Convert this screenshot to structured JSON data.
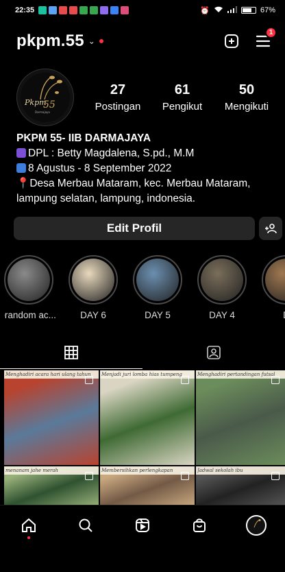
{
  "status_bar": {
    "time": "22:35",
    "battery": "67%",
    "notification_colors": [
      "#19c3a0",
      "#5ba4f5",
      "#e84b4b",
      "#e84b4b",
      "#38a84e",
      "#38a84e",
      "#8e6cf0",
      "#3b82f6",
      "#e04c7a"
    ]
  },
  "header": {
    "username": "pkpm.55",
    "notification_count": "1",
    "accent": "#ff3040"
  },
  "avatar": {
    "logo_text": "Pkpm55",
    "logo_sub": "Darmajaya"
  },
  "stats": [
    {
      "value": "27",
      "label": "Postingan"
    },
    {
      "value": "61",
      "label": "Pengikut"
    },
    {
      "value": "50",
      "label": "Mengikuti"
    }
  ],
  "bio": {
    "name": "PKPM 55- IIB DARMAJAYA",
    "line1": "DPL : Betty Magdalena, S.pd., M.M",
    "line2": "8 Agustus - 8 September 2022",
    "line3": "Desa Merbau Mataram, kec. Merbau Mataram, lampung selatan, lampung, indonesia."
  },
  "buttons": {
    "edit_profile": "Edit Profil"
  },
  "highlights": [
    {
      "label": "•random ac...",
      "color": "#8a8a8a"
    },
    {
      "label": "DAY 6",
      "color": "#e8d9bd"
    },
    {
      "label": "DAY 5",
      "color": "#6b8fb0"
    },
    {
      "label": "DAY 4",
      "color": "#7a6e5a"
    },
    {
      "label": "D",
      "color": "#a07850"
    }
  ],
  "posts": [
    {
      "caption": "Menghadiri acara hari ulang tahun",
      "colors": [
        "#5a7a9a",
        "#b8432f"
      ]
    },
    {
      "caption": "Menjadi juri lomba hias tumpeng",
      "colors": [
        "#3f6a34",
        "#d9d5c2"
      ]
    },
    {
      "caption": "Menghadiri pertandingan futsal",
      "colors": [
        "#4a5a4a",
        "#6b8c5b"
      ]
    },
    {
      "caption": "menanam jahe merah",
      "colors": [
        "#2f5230",
        "#98b07a"
      ]
    },
    {
      "caption": "Membersihkan perlengkapan",
      "colors": [
        "#735a46",
        "#c9a880"
      ]
    },
    {
      "caption": "Jadwal sekolah ibu",
      "colors": [
        "#222",
        "#555"
      ]
    }
  ]
}
